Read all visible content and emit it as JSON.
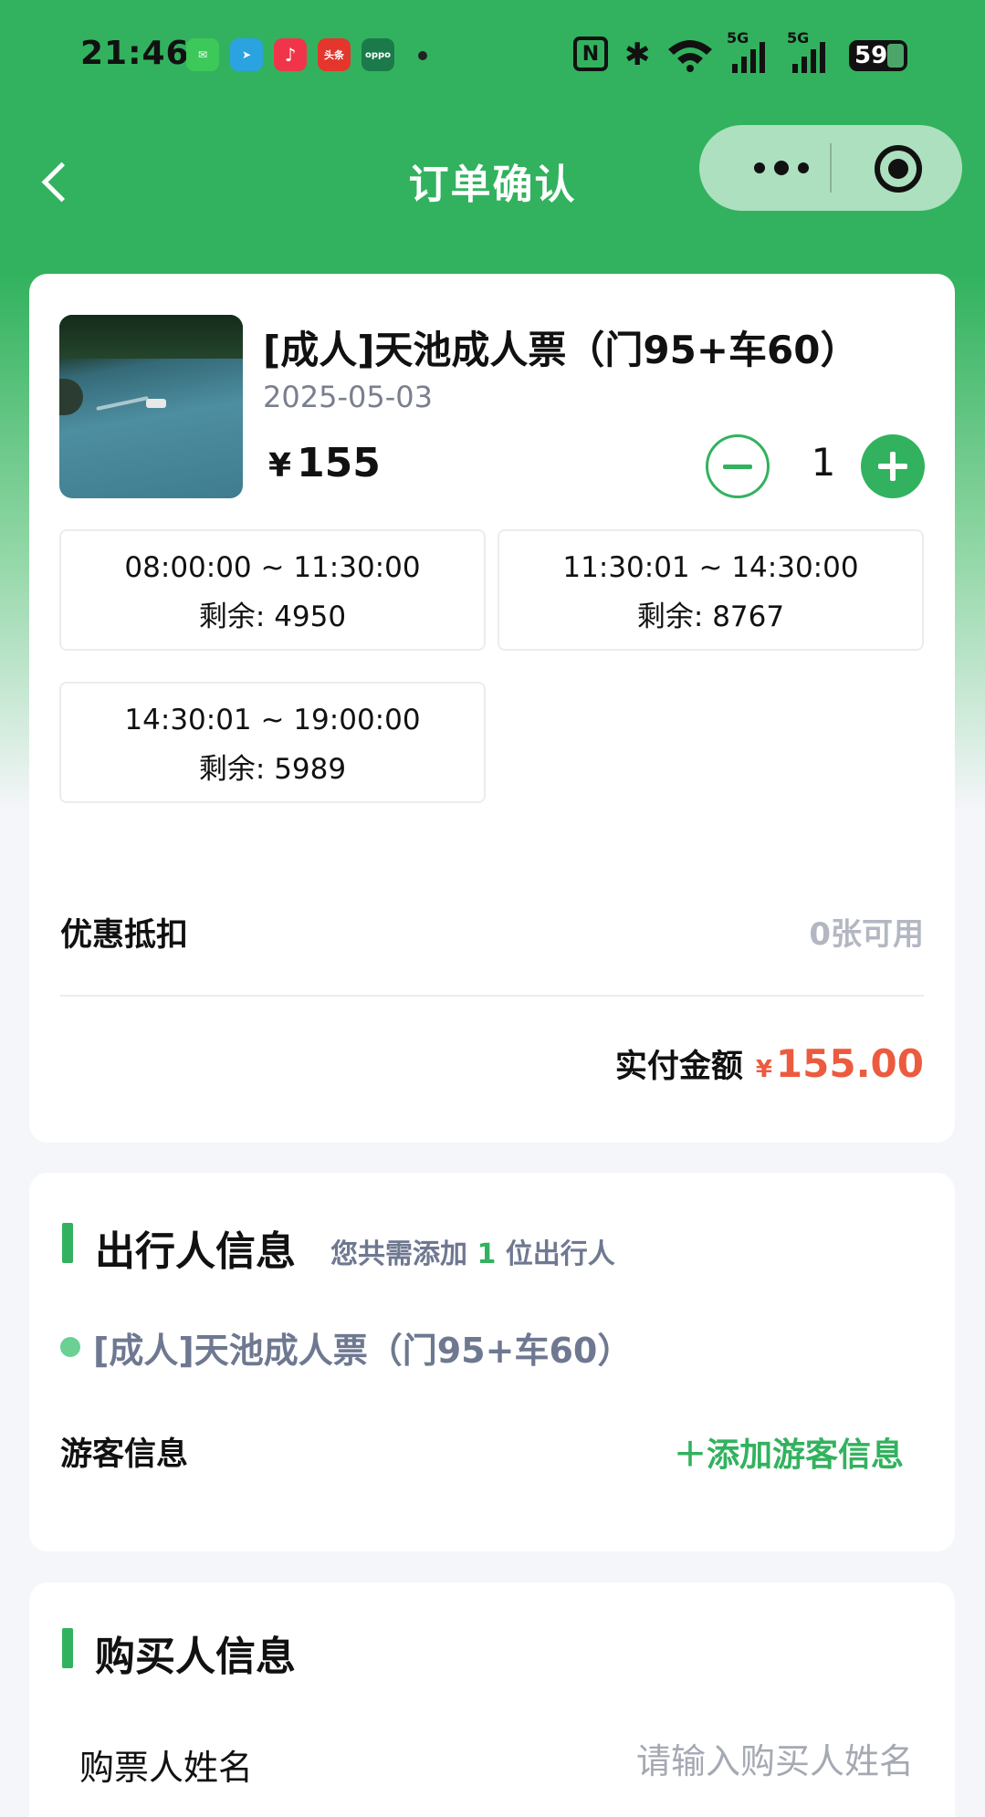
{
  "status_bar": {
    "time": "21:46",
    "apps": [
      {
        "name": "messages-app-icon",
        "color": "#3dc95a",
        "glyph": "✉"
      },
      {
        "name": "telegram-app-icon",
        "color": "#2aa3e0",
        "glyph": "➤"
      },
      {
        "name": "music-app-icon",
        "color": "#f0354a",
        "glyph": "♪"
      },
      {
        "name": "toutiao-app-icon",
        "color": "#e4362c",
        "glyph": "头条"
      },
      {
        "name": "oppo-app-icon",
        "color": "#1b7a4a",
        "glyph": "oppo"
      }
    ],
    "network_1": "5G",
    "network_2": "5G",
    "battery": "59"
  },
  "nav": {
    "title": "订单确认"
  },
  "product": {
    "title": "[成人]天池成人票（门95+车60）",
    "date": "2025-05-03",
    "currency": "¥",
    "price": "155",
    "quantity": "1"
  },
  "time_slots": [
    {
      "time": "08:00:00 ~ 11:30:00",
      "remaining": "剩余: 4950"
    },
    {
      "time": "11:30:01 ~ 14:30:00",
      "remaining": "剩余: 8767"
    },
    {
      "time": "14:30:01 ~ 19:00:00",
      "remaining": "剩余: 5989"
    }
  ],
  "discount": {
    "label": "优惠抵扣",
    "value": "0张可用"
  },
  "total": {
    "label": "实付金额",
    "currency": "¥",
    "amount": "155.00"
  },
  "traveler_section": {
    "title": "出行人信息",
    "hint_prefix": "您共需添加",
    "hint_count": "1",
    "hint_suffix": "位出行人",
    "ticket_name": "[成人]天池成人票（门95+车60）",
    "visitor_label": "游客信息",
    "add_visitor": "＋添加游客信息"
  },
  "buyer_section": {
    "title": "购买人信息",
    "name_label": "购票人姓名",
    "name_placeholder": "请输入购买人姓名",
    "name_value": ""
  },
  "colors": {
    "brand_green": "#32b25e",
    "price_red": "#ec5b3f",
    "muted_text": "#6f7891"
  }
}
